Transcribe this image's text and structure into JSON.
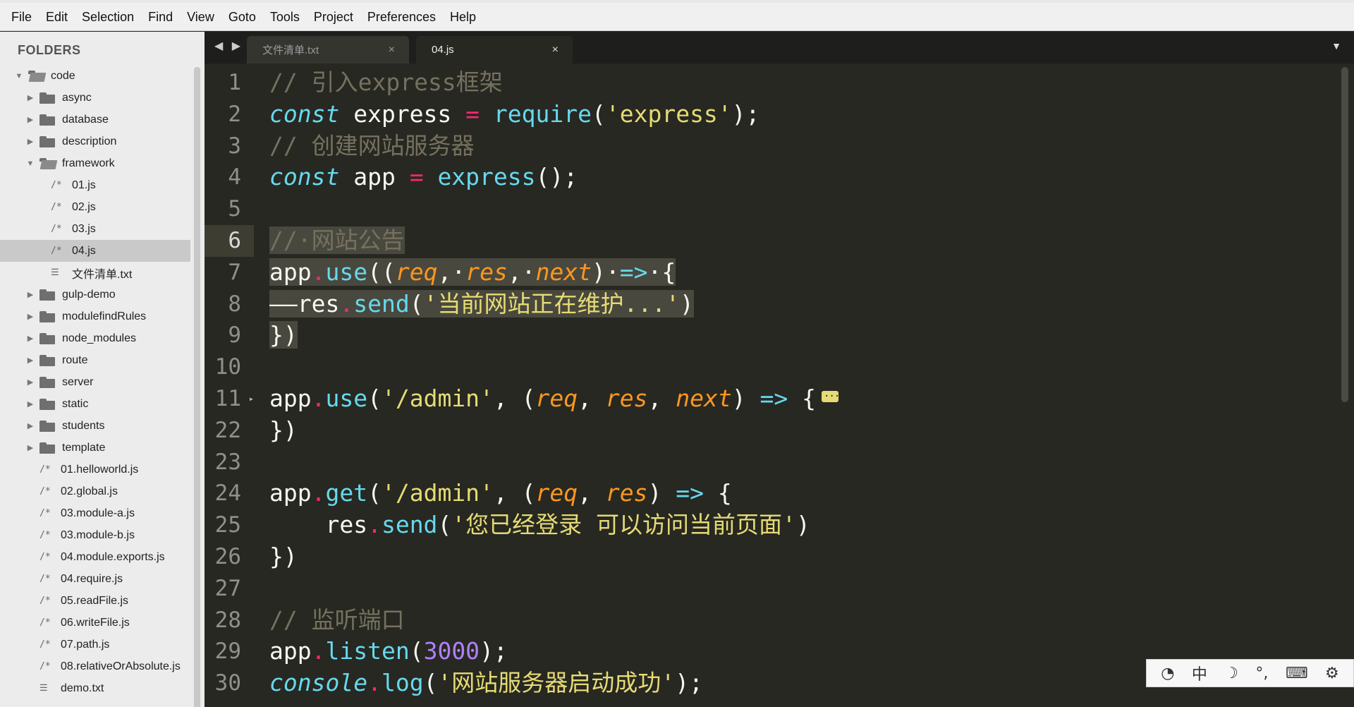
{
  "menu": [
    "File",
    "Edit",
    "Selection",
    "Find",
    "View",
    "Goto",
    "Tools",
    "Project",
    "Preferences",
    "Help"
  ],
  "sidebar": {
    "title": "FOLDERS",
    "items": [
      {
        "label": "code",
        "type": "folder-open",
        "depth": 0
      },
      {
        "label": "async",
        "type": "folder",
        "depth": 1
      },
      {
        "label": "database",
        "type": "folder",
        "depth": 1
      },
      {
        "label": "description",
        "type": "folder",
        "depth": 1
      },
      {
        "label": "framework",
        "type": "folder-open",
        "depth": 1
      },
      {
        "label": "01.js",
        "type": "js",
        "depth": 2
      },
      {
        "label": "02.js",
        "type": "js",
        "depth": 2
      },
      {
        "label": "03.js",
        "type": "js",
        "depth": 2
      },
      {
        "label": "04.js",
        "type": "js",
        "depth": 2,
        "selected": true
      },
      {
        "label": "文件清单.txt",
        "type": "txt",
        "depth": 2
      },
      {
        "label": "gulp-demo",
        "type": "folder",
        "depth": 1
      },
      {
        "label": "modulefindRules",
        "type": "folder",
        "depth": 1
      },
      {
        "label": "node_modules",
        "type": "folder",
        "depth": 1
      },
      {
        "label": "route",
        "type": "folder",
        "depth": 1
      },
      {
        "label": "server",
        "type": "folder",
        "depth": 1
      },
      {
        "label": "static",
        "type": "folder",
        "depth": 1
      },
      {
        "label": "students",
        "type": "folder",
        "depth": 1
      },
      {
        "label": "template",
        "type": "folder",
        "depth": 1
      },
      {
        "label": "01.helloworld.js",
        "type": "js",
        "depth": 1
      },
      {
        "label": "02.global.js",
        "type": "js",
        "depth": 1
      },
      {
        "label": "03.module-a.js",
        "type": "js",
        "depth": 1
      },
      {
        "label": "03.module-b.js",
        "type": "js",
        "depth": 1
      },
      {
        "label": "04.module.exports.js",
        "type": "js",
        "depth": 1
      },
      {
        "label": "04.require.js",
        "type": "js",
        "depth": 1
      },
      {
        "label": "05.readFile.js",
        "type": "js",
        "depth": 1
      },
      {
        "label": "06.writeFile.js",
        "type": "js",
        "depth": 1
      },
      {
        "label": "07.path.js",
        "type": "js",
        "depth": 1
      },
      {
        "label": "08.relativeOrAbsolute.js",
        "type": "js",
        "depth": 1
      },
      {
        "label": "demo.txt",
        "type": "txt",
        "depth": 1
      }
    ]
  },
  "tabs": {
    "nav": "◀ ▶",
    "inactive": {
      "label": "文件清单.txt",
      "close": "×"
    },
    "active": {
      "label": "04.js",
      "close": "×"
    },
    "dropdown": "▼"
  },
  "editor": {
    "current_line": "6",
    "lines": [
      {
        "n": "1",
        "tokens": [
          {
            "t": "// 引入express框架",
            "c": "comment"
          }
        ]
      },
      {
        "n": "2",
        "tokens": [
          {
            "t": "const",
            "c": "kw"
          },
          {
            "t": " express ",
            "c": ""
          },
          {
            "t": "=",
            "c": "op"
          },
          {
            "t": " ",
            "c": ""
          },
          {
            "t": "require",
            "c": "fn"
          },
          {
            "t": "(",
            "c": ""
          },
          {
            "t": "'express'",
            "c": "str"
          },
          {
            "t": ");",
            "c": ""
          }
        ]
      },
      {
        "n": "3",
        "tokens": [
          {
            "t": "// 创建网站服务器",
            "c": "comment"
          }
        ]
      },
      {
        "n": "4",
        "tokens": [
          {
            "t": "const",
            "c": "kw"
          },
          {
            "t": " app ",
            "c": ""
          },
          {
            "t": "=",
            "c": "op"
          },
          {
            "t": " ",
            "c": ""
          },
          {
            "t": "express",
            "c": "fn"
          },
          {
            "t": "();",
            "c": ""
          }
        ]
      },
      {
        "n": "5",
        "tokens": []
      },
      {
        "n": "6",
        "tokens": [
          {
            "t": "//·网站公告",
            "c": "comment sel"
          }
        ]
      },
      {
        "n": "7",
        "tokens": [
          {
            "t": "app",
            "c": "sel"
          },
          {
            "t": ".",
            "c": "op sel"
          },
          {
            "t": "use",
            "c": "fn sel"
          },
          {
            "t": "((",
            "c": "sel"
          },
          {
            "t": "req",
            "c": "param sel"
          },
          {
            "t": ",·",
            "c": "sel"
          },
          {
            "t": "res",
            "c": "param sel"
          },
          {
            "t": ",·",
            "c": "sel"
          },
          {
            "t": "next",
            "c": "param sel"
          },
          {
            "t": ")·",
            "c": "sel"
          },
          {
            "t": "=>",
            "c": "arrow sel"
          },
          {
            "t": "·{",
            "c": "sel"
          }
        ]
      },
      {
        "n": "8",
        "tokens": [
          {
            "t": "——res",
            "c": "sel"
          },
          {
            "t": ".",
            "c": "op sel"
          },
          {
            "t": "send",
            "c": "fn sel"
          },
          {
            "t": "(",
            "c": "sel"
          },
          {
            "t": "'当前网站正在维护...'",
            "c": "str sel"
          },
          {
            "t": ")",
            "c": "sel"
          }
        ]
      },
      {
        "n": "9",
        "tokens": [
          {
            "t": "})",
            "c": "sel"
          }
        ]
      },
      {
        "n": "10",
        "tokens": []
      },
      {
        "n": "11",
        "fold": "▸",
        "tokens": [
          {
            "t": "app",
            "c": ""
          },
          {
            "t": ".",
            "c": "op"
          },
          {
            "t": "use",
            "c": "fn"
          },
          {
            "t": "(",
            "c": ""
          },
          {
            "t": "'/admin'",
            "c": "str"
          },
          {
            "t": ", (",
            "c": ""
          },
          {
            "t": "req",
            "c": "param"
          },
          {
            "t": ", ",
            "c": ""
          },
          {
            "t": "res",
            "c": "param"
          },
          {
            "t": ", ",
            "c": ""
          },
          {
            "t": "next",
            "c": "param"
          },
          {
            "t": ") ",
            "c": ""
          },
          {
            "t": "=>",
            "c": "arrow"
          },
          {
            "t": " {",
            "c": ""
          }
        ],
        "badge": true
      },
      {
        "n": "22",
        "tokens": [
          {
            "t": "})",
            "c": ""
          }
        ]
      },
      {
        "n": "23",
        "tokens": []
      },
      {
        "n": "24",
        "tokens": [
          {
            "t": "app",
            "c": ""
          },
          {
            "t": ".",
            "c": "op"
          },
          {
            "t": "get",
            "c": "fn"
          },
          {
            "t": "(",
            "c": ""
          },
          {
            "t": "'/admin'",
            "c": "str"
          },
          {
            "t": ", (",
            "c": ""
          },
          {
            "t": "req",
            "c": "param"
          },
          {
            "t": ", ",
            "c": ""
          },
          {
            "t": "res",
            "c": "param"
          },
          {
            "t": ") ",
            "c": ""
          },
          {
            "t": "=>",
            "c": "arrow"
          },
          {
            "t": " {",
            "c": ""
          }
        ]
      },
      {
        "n": "25",
        "tokens": [
          {
            "t": "    res",
            "c": ""
          },
          {
            "t": ".",
            "c": "op"
          },
          {
            "t": "send",
            "c": "fn"
          },
          {
            "t": "(",
            "c": ""
          },
          {
            "t": "'您已经登录 可以访问当前页面'",
            "c": "str"
          },
          {
            "t": ")",
            "c": ""
          }
        ]
      },
      {
        "n": "26",
        "tokens": [
          {
            "t": "})",
            "c": ""
          }
        ]
      },
      {
        "n": "27",
        "tokens": []
      },
      {
        "n": "28",
        "tokens": [
          {
            "t": "// 监听端口",
            "c": "comment"
          }
        ]
      },
      {
        "n": "29",
        "tokens": [
          {
            "t": "app",
            "c": ""
          },
          {
            "t": ".",
            "c": "op"
          },
          {
            "t": "listen",
            "c": "fn"
          },
          {
            "t": "(",
            "c": ""
          },
          {
            "t": "3000",
            "c": "num"
          },
          {
            "t": ");",
            "c": ""
          }
        ]
      },
      {
        "n": "30",
        "tokens": [
          {
            "t": "console",
            "c": "kw"
          },
          {
            "t": ".",
            "c": "op"
          },
          {
            "t": "log",
            "c": "fn"
          },
          {
            "t": "(",
            "c": ""
          },
          {
            "t": "'网站服务器启动成功'",
            "c": "str"
          },
          {
            "t": ");",
            "c": ""
          }
        ]
      }
    ]
  },
  "ime": {
    "items": [
      {
        "label": "◔",
        "name": "ime-logo-icon"
      },
      {
        "label": "中",
        "name": "ime-chinese-mode"
      },
      {
        "label": "☽",
        "name": "ime-halfwidth-icon"
      },
      {
        "label": "°,",
        "name": "ime-punctuation-icon"
      },
      {
        "label": "⌨",
        "name": "ime-keyboard-icon"
      },
      {
        "label": "⚙",
        "name": "ime-settings-icon"
      }
    ]
  },
  "colors": {
    "editor_bg": "#272822",
    "comment": "#75715e",
    "keyword": "#66d9ef",
    "operator": "#f92672",
    "string": "#e6db74",
    "number": "#ae81ff",
    "param": "#fd971f",
    "selection": "#49483e"
  }
}
